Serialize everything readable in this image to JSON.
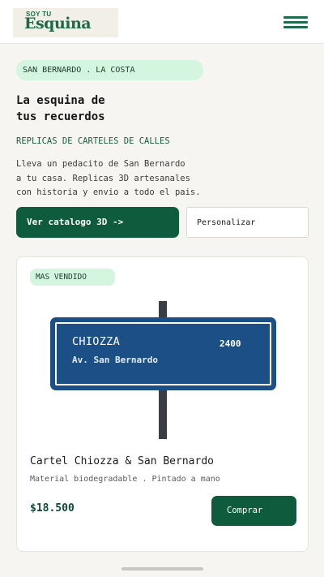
{
  "brand": {
    "logo_small": "SOY TU",
    "logo_big": "Esquina",
    "accent": "#0f5b3e",
    "light_accent": "#d4f5df"
  },
  "header": {
    "menu_icon": "hamburger-menu-icon"
  },
  "hero": {
    "badge": "SAN BERNARDO . LA COSTA",
    "title_line1": "La esquina de",
    "title_line2": "tus recuerdos",
    "kicker": "REPLICAS DE CARTELES DE CALLES",
    "desc_line1": "Lleva un pedacito de San Bernardo",
    "desc_line2": "a tu casa. Replicas 3D artesanales",
    "desc_line3": "con historia y envio a todo el pais.",
    "primary_button": "Ver catalogo 3D ->",
    "secondary_button": "Personalizar"
  },
  "product": {
    "tag": "MAS VENDIDO",
    "sign": {
      "street": "CHIOZZA",
      "number": "2400",
      "avenue": "Av. San Bernardo",
      "color": "#1b4f85"
    },
    "name": "Cartel Chiozza & San Bernardo",
    "meta": "Material biodegradable . Pintado a mano",
    "price": "$18.500",
    "buy_button": "Comprar"
  }
}
